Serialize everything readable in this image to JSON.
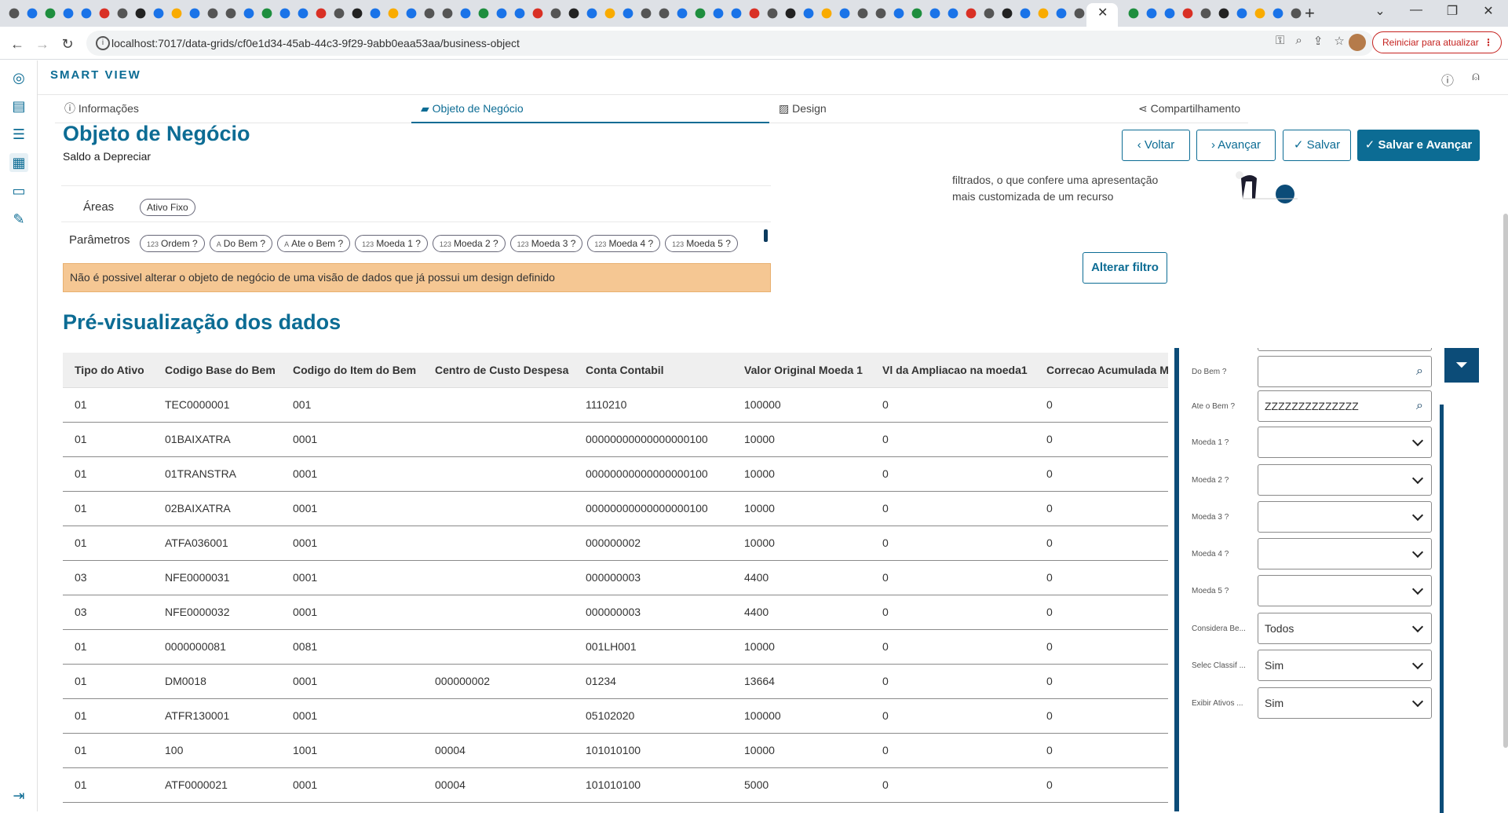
{
  "browser": {
    "url": "localhost:7017/data-grids/cf0e1d34-45ab-44c3-9f29-9abb0eaa53aa/business-object",
    "update_button": "Reiniciar para atualizar"
  },
  "app": {
    "brand": "SMART VIEW"
  },
  "tabs": [
    {
      "label": "Informações",
      "icon": "info-icon"
    },
    {
      "label": "Objeto de Negócio",
      "icon": "briefcase-icon"
    },
    {
      "label": "Design",
      "icon": "image-icon"
    },
    {
      "label": "Compartilhamento",
      "icon": "share-icon"
    }
  ],
  "header": {
    "title": "Objeto de Negócio",
    "subtitle": "Saldo a Depreciar",
    "back": "Voltar",
    "next": "Avançar",
    "save": "Salvar",
    "save_next": "Salvar e Avançar"
  },
  "config": {
    "areas_label": "Áreas",
    "areas": [
      "Ativo Fixo"
    ],
    "params_label": "Parâmetros",
    "params": [
      {
        "prefix": "123",
        "label": "Ordem ?"
      },
      {
        "prefix": "A",
        "label": "Do Bem ?"
      },
      {
        "prefix": "A",
        "label": "Ate o Bem ?"
      },
      {
        "prefix": "123",
        "label": "Moeda 1 ?"
      },
      {
        "prefix": "123",
        "label": "Moeda 2 ?"
      },
      {
        "prefix": "123",
        "label": "Moeda 3 ?"
      },
      {
        "prefix": "123",
        "label": "Moeda 4 ?"
      },
      {
        "prefix": "123",
        "label": "Moeda 5 ?"
      }
    ]
  },
  "warning": "Não é possivel alterar o objeto de negócio de uma visão de dados que já possui um design definido",
  "filter_info": {
    "text_line1": "filtrados, o que confere uma apresentação",
    "text_line2": "mais customizada de um recurso",
    "alter_button": "Alterar filtro"
  },
  "preview": {
    "title": "Pré-visualização dos dados",
    "columns": [
      "Tipo do Ativo",
      "Codigo Base do Bem",
      "Codigo do Item do Bem",
      "Centro de Custo Despesa",
      "Conta Contabil",
      "Valor Original Moeda 1",
      "Vl da Ampliacao na moeda1",
      "Correcao Acumulada Mo"
    ],
    "rows": [
      [
        "01",
        "TEC0000001",
        "001",
        "",
        "1110210",
        "100000",
        "0",
        "0"
      ],
      [
        "01",
        "01BAIXATRA",
        "0001",
        "",
        "00000000000000000100",
        "10000",
        "0",
        "0"
      ],
      [
        "01",
        "01TRANSTRA",
        "0001",
        "",
        "00000000000000000100",
        "10000",
        "0",
        "0"
      ],
      [
        "01",
        "02BAIXATRA",
        "0001",
        "",
        "00000000000000000100",
        "10000",
        "0",
        "0"
      ],
      [
        "01",
        "ATFA036001",
        "0001",
        "",
        "000000002",
        "10000",
        "0",
        "0"
      ],
      [
        "03",
        "NFE0000031",
        "0001",
        "",
        "000000003",
        "4400",
        "0",
        "0"
      ],
      [
        "03",
        "NFE0000032",
        "0001",
        "",
        "000000003",
        "4400",
        "0",
        "0"
      ],
      [
        "01",
        "0000000081",
        "0081",
        "",
        "001LH001",
        "10000",
        "0",
        "0"
      ],
      [
        "01",
        "DM0018",
        "0001",
        "000000002",
        "01234",
        "13664",
        "0",
        "0"
      ],
      [
        "01",
        "ATFR130001",
        "0001",
        "",
        "05102020",
        "100000",
        "0",
        "0"
      ],
      [
        "01",
        "100",
        "1001",
        "00004",
        "101010100",
        "10000",
        "0",
        "0"
      ],
      [
        "01",
        "ATF0000021",
        "0001",
        "00004",
        "101010100",
        "5000",
        "0",
        "0"
      ]
    ]
  },
  "filters": [
    {
      "label": "Do Bem ?",
      "value": "",
      "kind": "search"
    },
    {
      "label": "Ate o Bem ?",
      "value": "ZZZZZZZZZZZZZZ",
      "kind": "search"
    },
    {
      "label": "Moeda 1 ?",
      "value": "",
      "kind": "select"
    },
    {
      "label": "Moeda 2 ?",
      "value": "",
      "kind": "select"
    },
    {
      "label": "Moeda 3 ?",
      "value": "",
      "kind": "select"
    },
    {
      "label": "Moeda 4 ?",
      "value": "",
      "kind": "select"
    },
    {
      "label": "Moeda 5 ?",
      "value": "",
      "kind": "select"
    },
    {
      "label": "Considera Be...",
      "value": "Todos",
      "kind": "select"
    },
    {
      "label": "Selec Classif ...",
      "value": "Sim",
      "kind": "select"
    },
    {
      "label": "Exibir Ativos ...",
      "value": "Sim",
      "kind": "select"
    }
  ],
  "colors": {
    "primary": "#0c6c94",
    "panel_dark": "#0c4c78",
    "warning_bg": "#f5c793"
  }
}
